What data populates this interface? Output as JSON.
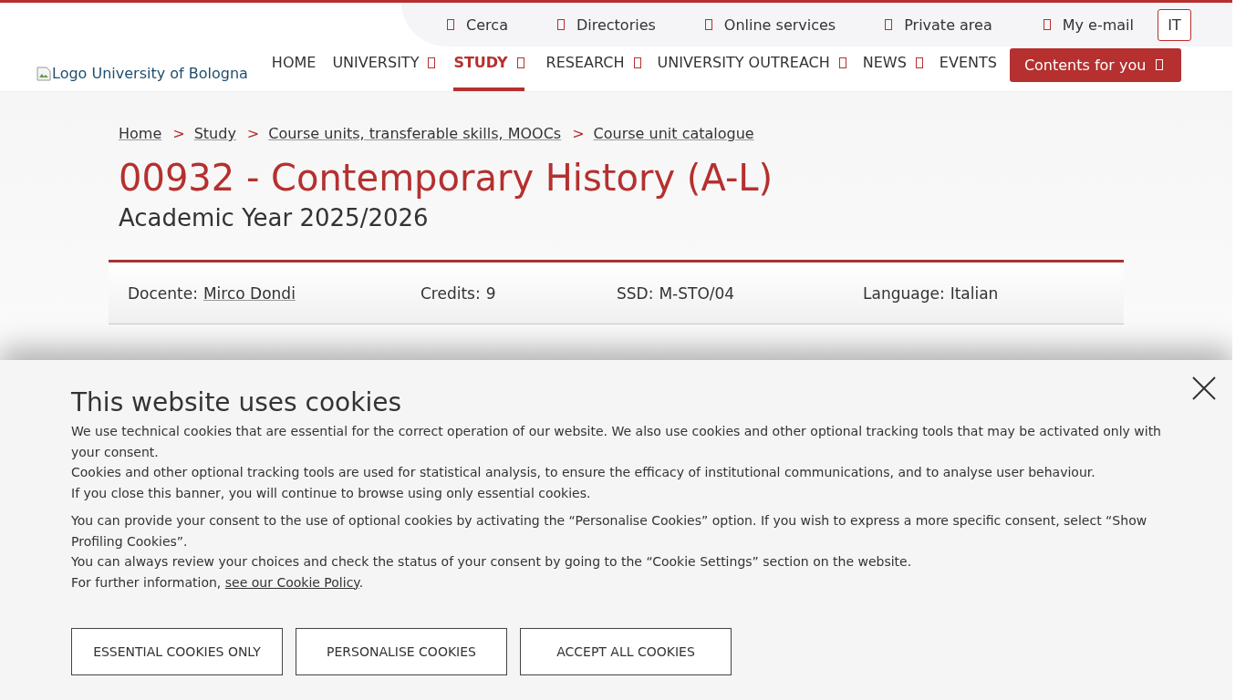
{
  "utility_links": [
    {
      "label": "Cerca"
    },
    {
      "label": "Directories"
    },
    {
      "label": "Online services"
    },
    {
      "label": "Private area"
    },
    {
      "label": "My e-mail"
    }
  ],
  "language_button": "IT",
  "logo": {
    "alt": "Logo University of Bologna"
  },
  "nav": [
    {
      "label": "HOME",
      "selected": false,
      "has_menu": false
    },
    {
      "label": "UNIVERSITY",
      "selected": false,
      "has_menu": true
    },
    {
      "label": "STUDY",
      "selected": true,
      "has_menu": true
    },
    {
      "label": "RESEARCH",
      "selected": false,
      "has_menu": true
    },
    {
      "label": "UNIVERSITY OUTREACH",
      "selected": false,
      "has_menu": true
    },
    {
      "label": "NEWS",
      "selected": false,
      "has_menu": true
    },
    {
      "label": "EVENTS",
      "selected": false,
      "has_menu": false
    }
  ],
  "contents_button": "Contents for you",
  "breadcrumb": [
    {
      "label": "Home"
    },
    {
      "label": "Study"
    },
    {
      "label": "Course units, transferable skills, MOOCs"
    },
    {
      "label": "Course unit catalogue"
    }
  ],
  "breadcrumb_separator": ">",
  "title": "00932 - Contemporary History (A-L)",
  "subtitle": "Academic Year 2025/2026",
  "info": [
    {
      "label": "Docente:",
      "value": "Mirco Dondi",
      "link": true
    },
    {
      "label": "Credits:",
      "value": "9",
      "link": false
    },
    {
      "label": "SSD:",
      "value": "M-STO/04",
      "link": false
    },
    {
      "label": "Language:",
      "value": "Italian",
      "link": false
    }
  ],
  "cookie_banner": {
    "title": "This website uses cookies",
    "paragraphs": [
      [
        "We use technical cookies that are essential for the correct operation of our website. We also use cookies and other optional tracking tools that may be activated only with your consent.",
        "Cookies and other optional tracking tools are used for statistical analysis, to ensure the efficacy of institutional communications, and to analyse user behaviour.",
        "If you close this banner, you will continue to browse using only essential cookies."
      ],
      [
        "You can provide your consent to the use of optional cookies by activating the “Personalise Cookies” option. If you wish to express a more specific consent, select “Show Profiling Cookies”.",
        "You can always review your choices and check the status of your consent by going to the “Cookie Settings” section on the website."
      ]
    ],
    "info_prefix": "For further information,",
    "info_link": "see our Cookie Policy",
    "info_suffix": ".",
    "buttons": [
      "ESSENTIAL COOKIES ONLY",
      "PERSONALISE COOKIES",
      "ACCEPT ALL COOKIES"
    ]
  }
}
